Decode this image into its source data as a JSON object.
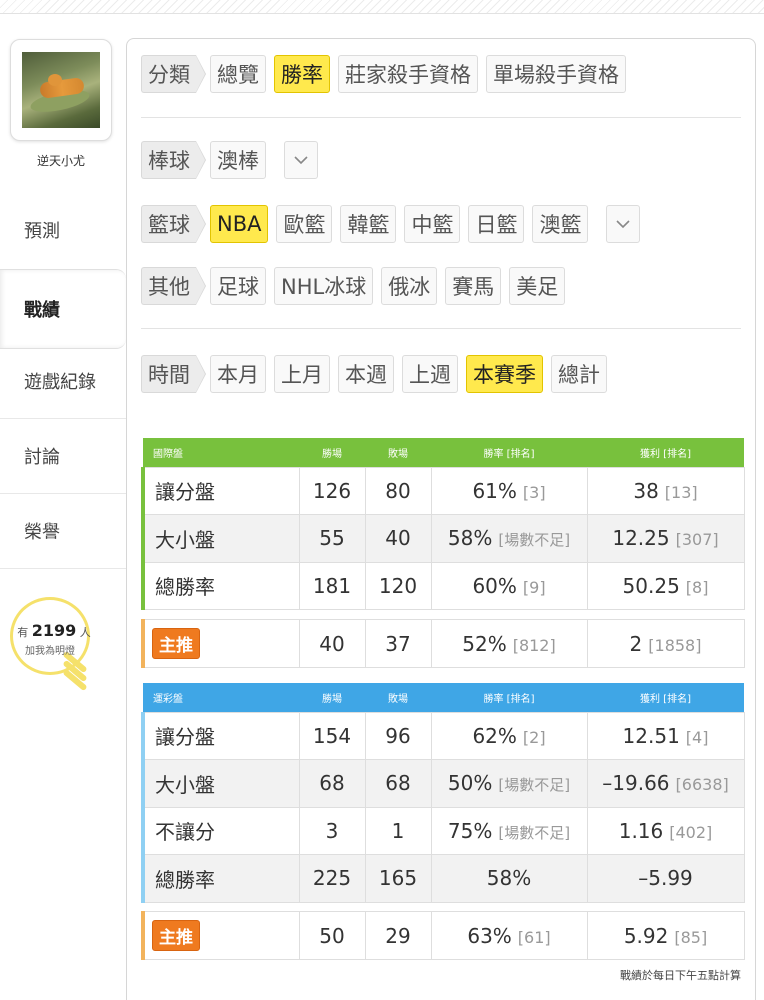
{
  "user": {
    "name": "逆天小尤"
  },
  "nav": [
    {
      "label": "預測"
    },
    {
      "label": "戰績"
    },
    {
      "label": "遊戲紀錄"
    },
    {
      "label": "討論"
    },
    {
      "label": "榮譽"
    }
  ],
  "fans": {
    "prefix": "有",
    "count": "2199",
    "suffix": "人",
    "caption": "加我為明燈"
  },
  "filters": {
    "category": {
      "label": "分類",
      "chips": [
        "總覽",
        "勝率",
        "莊家殺手資格",
        "單場殺手資格"
      ],
      "selected": "勝率"
    },
    "baseball": {
      "label": "棒球",
      "chips": [
        "澳棒"
      ]
    },
    "basketball": {
      "label": "籃球",
      "chips": [
        "NBA",
        "歐籃",
        "韓籃",
        "中籃",
        "日籃",
        "澳籃"
      ],
      "selected": "NBA"
    },
    "other": {
      "label": "其他",
      "chips": [
        "足球",
        "NHL冰球",
        "俄冰",
        "賽馬",
        "美足"
      ]
    },
    "time": {
      "label": "時間",
      "chips": [
        "本月",
        "上月",
        "本週",
        "上週",
        "本賽季",
        "總計"
      ],
      "selected": "本賽季"
    }
  },
  "colors": {
    "green": "#78c13d",
    "blue": "#3fa6e6",
    "yellow": "#ffe94d",
    "orange": "#ef7a1f"
  },
  "intl_table": {
    "headers": [
      "國際盤",
      "勝場",
      "敗場",
      "勝率 [排名]",
      "獲利 [排名]"
    ],
    "rows": [
      {
        "name": "讓分盤",
        "win": "126",
        "lose": "80",
        "rate": "61%",
        "rate_rank": "[3]",
        "profit": "38",
        "profit_rank": "[13]"
      },
      {
        "name": "大小盤",
        "win": "55",
        "lose": "40",
        "rate": "58%",
        "rate_rank": "[場數不足]",
        "profit": "12.25",
        "profit_rank": "[307]"
      },
      {
        "name": "總勝率",
        "win": "181",
        "lose": "120",
        "rate": "60%",
        "rate_rank": "[9]",
        "profit": "50.25",
        "profit_rank": "[8]"
      }
    ],
    "star": {
      "label": "主推",
      "win": "40",
      "lose": "37",
      "rate": "52%",
      "rate_rank": "[812]",
      "profit": "2",
      "profit_rank": "[1858]"
    }
  },
  "sports_table": {
    "headers": [
      "運彩盤",
      "勝場",
      "敗場",
      "勝率 [排名]",
      "獲利 [排名]"
    ],
    "rows": [
      {
        "name": "讓分盤",
        "win": "154",
        "lose": "96",
        "rate": "62%",
        "rate_rank": "[2]",
        "profit": "12.51",
        "profit_rank": "[4]"
      },
      {
        "name": "大小盤",
        "win": "68",
        "lose": "68",
        "rate": "50%",
        "rate_rank": "[場數不足]",
        "profit": "–19.66",
        "profit_rank": "[6638]"
      },
      {
        "name": "不讓分",
        "win": "3",
        "lose": "1",
        "rate": "75%",
        "rate_rank": "[場數不足]",
        "profit": "1.16",
        "profit_rank": "[402]"
      },
      {
        "name": "總勝率",
        "win": "225",
        "lose": "165",
        "rate": "58%",
        "rate_rank": "",
        "profit": "–5.99",
        "profit_rank": ""
      }
    ],
    "star": {
      "label": "主推",
      "win": "50",
      "lose": "29",
      "rate": "63%",
      "rate_rank": "[61]",
      "profit": "5.92",
      "profit_rank": "[85]"
    }
  },
  "footnote": "戰績於每日下午五點計算"
}
